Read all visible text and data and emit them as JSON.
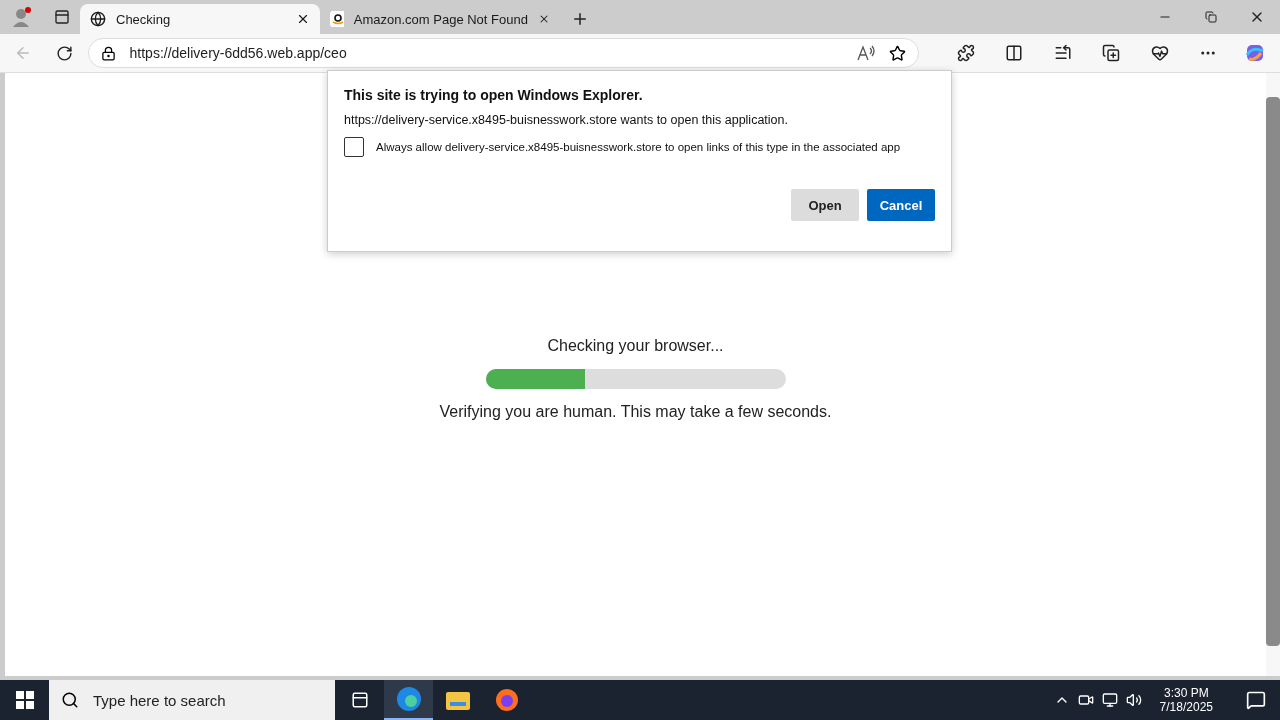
{
  "tabs": [
    {
      "title": "Checking",
      "selected": true,
      "kind": "globe"
    },
    {
      "title": "Amazon.com Page Not Found",
      "selected": false,
      "kind": "amazon"
    }
  ],
  "address_bar": {
    "url": "https://delivery-6dd56.web.app/ceo"
  },
  "dialog": {
    "title": "This site is trying to open Windows Explorer.",
    "message": "https://delivery-service.x8495-buisnesswork.store wants to open this application.",
    "checkbox": {
      "label": "Always allow delivery-service.x8495-buisnesswork.store to open links of this type in the associated app",
      "checked": false
    },
    "buttons": [
      {
        "label": "Open",
        "kind": "secondary"
      },
      {
        "label": "Cancel",
        "kind": "primary"
      }
    ]
  },
  "page": {
    "heading": "Checking your browser...",
    "progress": {
      "level": 0.33
    },
    "message": "Verifying you are human. This may take a few seconds."
  },
  "taskbar": {
    "search": {
      "placeholder": "Type here to search"
    },
    "time": "3:30 PM",
    "date": "7/18/2025"
  }
}
